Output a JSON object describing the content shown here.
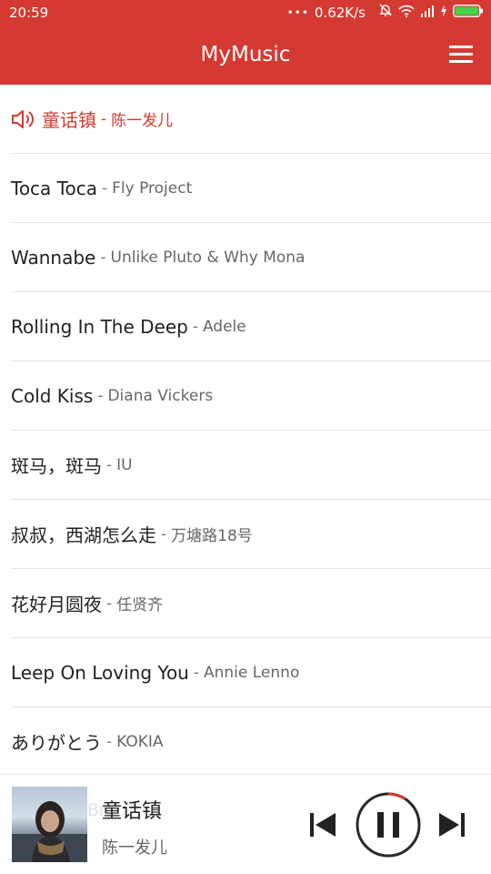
{
  "status_bar": {
    "time": "20:59",
    "dots": "•••",
    "speed": "0.62K/s"
  },
  "app_bar": {
    "title": "MyMusic",
    "menu_icon": "hamburger-menu-icon"
  },
  "songs": [
    {
      "name": "童话镇",
      "sep": "-",
      "artist": "陈一发儿",
      "playing": true
    },
    {
      "name": "Toca Toca",
      "sep": "-",
      "artist": "Fly Project"
    },
    {
      "name": "Wannabe",
      "sep": "-",
      "artist": "Unlike Pluto & Why Mona"
    },
    {
      "name": "Rolling In The Deep",
      "sep": "-",
      "artist": "Adele"
    },
    {
      "name": "Cold Kiss",
      "sep": "-",
      "artist": "Diana Vickers"
    },
    {
      "name": "斑马，斑马",
      "sep": "-",
      "artist": "IU"
    },
    {
      "name": "叔叔，西湖怎么走",
      "sep": "-",
      "artist": "万塘路18号"
    },
    {
      "name": "花好月圆夜",
      "sep": "-",
      "artist": "任贤齐"
    },
    {
      "name": "Leep On Loving You",
      "sep": "-",
      "artist": "Annie Lenno"
    },
    {
      "name": "ありがとう",
      "sep": "-",
      "artist": "KOKIA"
    }
  ],
  "player": {
    "title": "童话镇",
    "artist": "陈一发儿",
    "ghost_row": "Bill & Brod",
    "accent": "#d43a31"
  },
  "colors": {
    "primary": "#d43a31",
    "divider": "#e5e5e5"
  }
}
